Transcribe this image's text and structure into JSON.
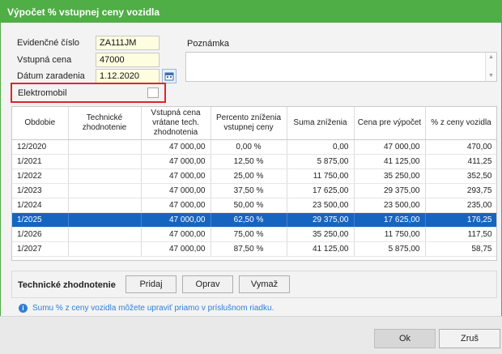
{
  "window": {
    "title": "Výpočet % vstupnej ceny vozidla"
  },
  "form": {
    "evidencne_cislo": {
      "label": "Evidenčné číslo",
      "value": "ZA111JM"
    },
    "vstupna_cena": {
      "label": "Vstupná cena",
      "value": "47000"
    },
    "datum_zaradenia": {
      "label": "Dátum zaradenia",
      "value": "1.12.2020"
    },
    "poznamka": {
      "label": "Poznámka",
      "value": ""
    },
    "elektromobil": {
      "label": "Elektromobil",
      "checked": false
    }
  },
  "table": {
    "columns": [
      "Obdobie",
      "Technické zhodnotenie",
      "Vstupná cena vrátane tech. zhodnotenia",
      "Percento zníženia vstupnej ceny",
      "Suma zníženia",
      "Cena pre výpočet",
      "% z ceny vozidla"
    ],
    "selected_row": 5,
    "rows": [
      [
        "12/2020",
        "",
        "47 000,00",
        "0,00 %",
        "0,00",
        "47 000,00",
        "470,00"
      ],
      [
        "1/2021",
        "",
        "47 000,00",
        "12,50 %",
        "5 875,00",
        "41 125,00",
        "411,25"
      ],
      [
        "1/2022",
        "",
        "47 000,00",
        "25,00 %",
        "11 750,00",
        "35 250,00",
        "352,50"
      ],
      [
        "1/2023",
        "",
        "47 000,00",
        "37,50 %",
        "17 625,00",
        "29 375,00",
        "293,75"
      ],
      [
        "1/2024",
        "",
        "47 000,00",
        "50,00 %",
        "23 500,00",
        "23 500,00",
        "235,00"
      ],
      [
        "1/2025",
        "",
        "47 000,00",
        "62,50 %",
        "29 375,00",
        "17 625,00",
        "176,25"
      ],
      [
        "1/2026",
        "",
        "47 000,00",
        "75,00 %",
        "35 250,00",
        "11 750,00",
        "117,50"
      ],
      [
        "1/2027",
        "",
        "47 000,00",
        "87,50 %",
        "41 125,00",
        "5 875,00",
        "58,75"
      ]
    ]
  },
  "technicke_zhodnotenie": {
    "title": "Technické zhodnotenie",
    "add_label": "Pridaj",
    "edit_label": "Oprav",
    "delete_label": "Vymaž"
  },
  "info": {
    "icon": "info-icon",
    "text": "Sumu % z ceny vozidla môžete upraviť priamo v príslušnom riadku."
  },
  "footer": {
    "ok_label": "Ok",
    "cancel_label": "Zruš"
  },
  "colors": {
    "title_bar": "#4fae45",
    "selected_row": "#1565c0",
    "highlight_border": "#e2232a",
    "info": "#2f7fd6"
  }
}
